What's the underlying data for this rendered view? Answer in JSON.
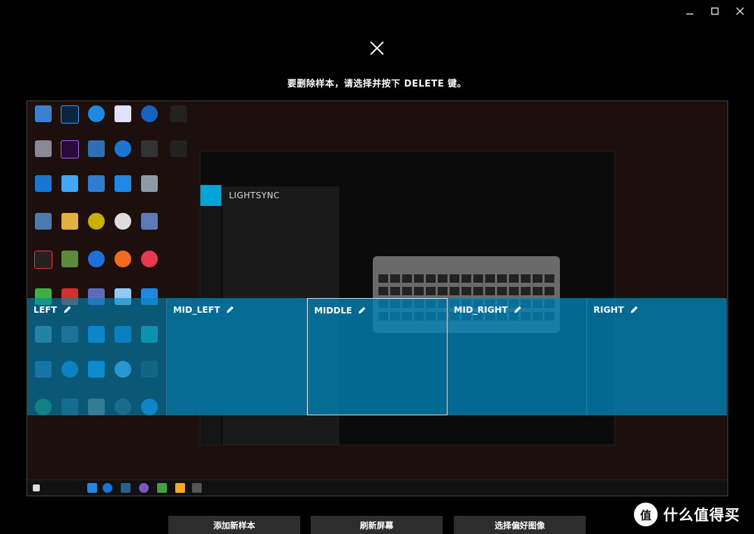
{
  "window": {
    "minimize_icon": "minimize-icon",
    "maximize_icon": "maximize-icon",
    "close_icon": "close-icon"
  },
  "instruction": "要删除样本，请选择并按下 DELETE 键。",
  "zones": [
    {
      "label": "LEFT"
    },
    {
      "label": "MID_LEFT"
    },
    {
      "label": "MIDDLE"
    },
    {
      "label": "MID_RIGHT"
    },
    {
      "label": "RIGHT"
    }
  ],
  "inner_app": {
    "title": "LIGHTSYNC"
  },
  "buttons": {
    "add_sample": "添加新样本",
    "refresh_screen": "刷新屏幕",
    "choose_image": "选择偏好图像"
  },
  "watermark": {
    "logo": "值",
    "text": "什么值得买"
  },
  "colors": {
    "accent": "#0085b8",
    "background": "#000000",
    "button": "#2d2d2d"
  }
}
